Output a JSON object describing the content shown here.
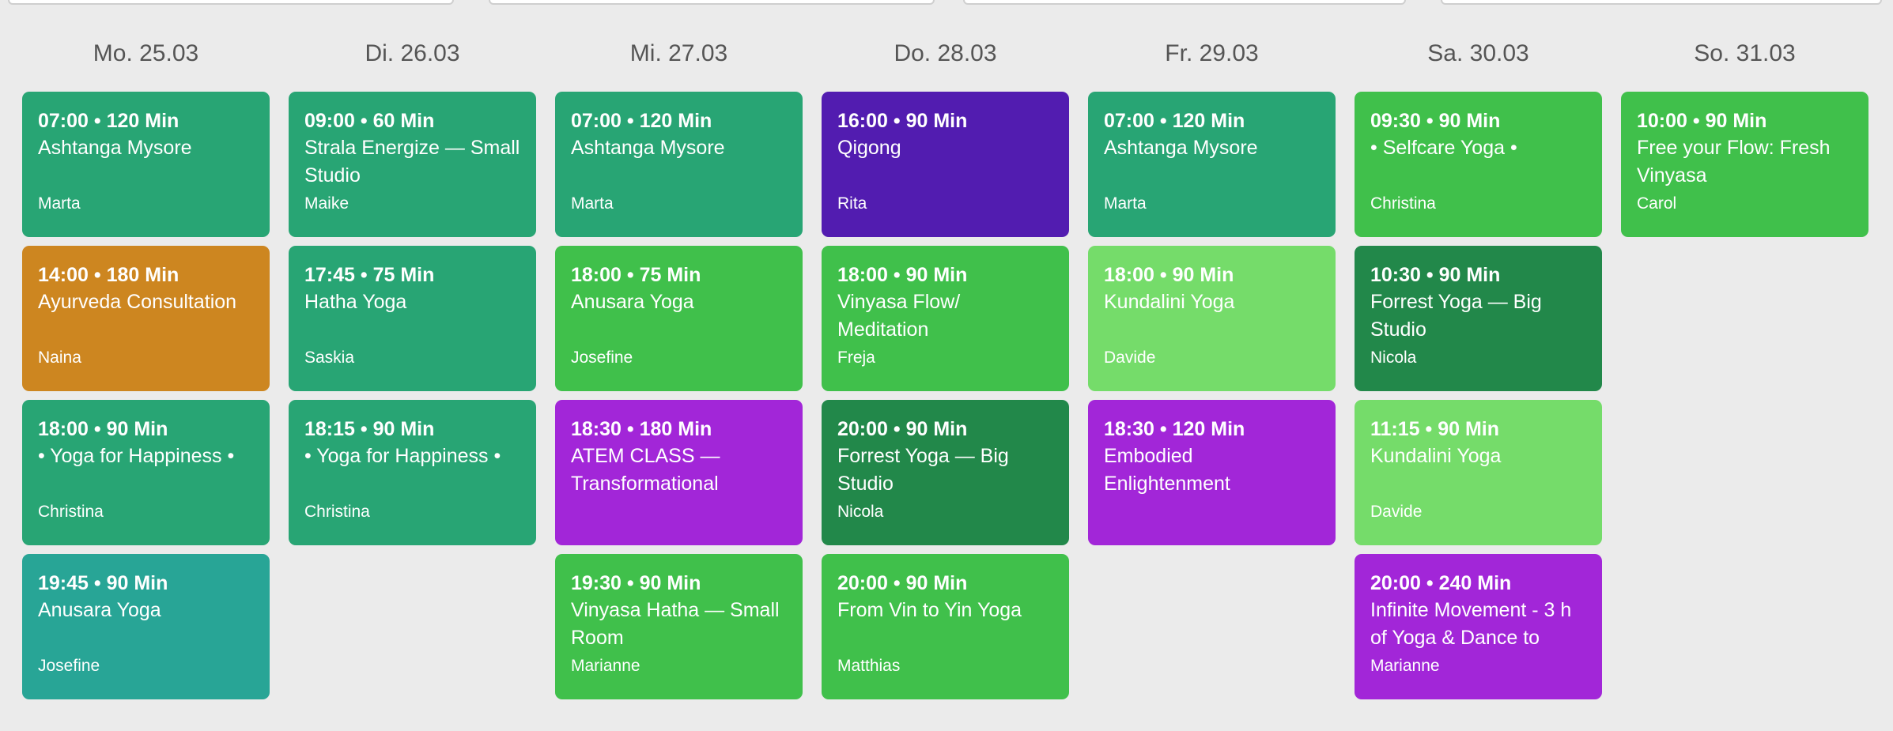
{
  "colors": {
    "teal": "#28a574",
    "dark_teal": "#28a596",
    "green": "#40c04b",
    "light_green": "#75dc6a",
    "dark_green": "#22884a",
    "purple": "#a226d8",
    "indigo": "#521cb0",
    "orange": "#cd8620",
    "background": "#ebebeb"
  },
  "days": [
    {
      "label": "Mo. 25.03",
      "classes": [
        {
          "time": "07:00 • 120 Min",
          "title": "Ashtanga Mysore",
          "teacher": "Marta",
          "color": "#28a574"
        },
        {
          "time": "14:00 • 180 Min",
          "title": "Ayurveda Consultation",
          "teacher": "Naina",
          "color": "#cd8620"
        },
        {
          "time": "18:00 • 90 Min",
          "title": "• Yoga for Happiness •",
          "teacher": "Christina",
          "color": "#28a574"
        },
        {
          "time": "19:45 • 90 Min",
          "title": "Anusara Yoga",
          "teacher": "Josefine",
          "color": "#28a596"
        }
      ]
    },
    {
      "label": "Di. 26.03",
      "classes": [
        {
          "time": "09:00 • 60 Min",
          "title": "Strala Energize — Small Studio",
          "teacher": "Maike",
          "color": "#28a574"
        },
        {
          "time": "17:45 • 75 Min",
          "title": "Hatha Yoga",
          "teacher": "Saskia",
          "color": "#28a574"
        },
        {
          "time": "18:15 • 90 Min",
          "title": "• Yoga for Happiness •",
          "teacher": "Christina",
          "color": "#28a574"
        }
      ]
    },
    {
      "label": "Mi. 27.03",
      "classes": [
        {
          "time": "07:00 • 120 Min",
          "title": "Ashtanga Mysore",
          "teacher": "Marta",
          "color": "#28a574"
        },
        {
          "time": "18:00 • 75 Min",
          "title": "Anusara Yoga",
          "teacher": "Josefine",
          "color": "#40c04b"
        },
        {
          "time": "18:30 • 180 Min",
          "title": "ATEM CLASS — Transformational",
          "teacher": "",
          "color": "#a226d8"
        },
        {
          "time": "19:30 • 90 Min",
          "title": "Vinyasa Hatha — Small Room",
          "teacher": "Marianne",
          "color": "#40c04b"
        }
      ]
    },
    {
      "label": "Do. 28.03",
      "classes": [
        {
          "time": "16:00 • 90 Min",
          "title": "Qigong",
          "teacher": "Rita",
          "color": "#521cb0"
        },
        {
          "time": "18:00 • 90 Min",
          "title": "Vinyasa Flow/ Meditation",
          "teacher": "Freja",
          "color": "#40c04b"
        },
        {
          "time": "20:00 • 90 Min",
          "title": "Forrest Yoga — Big Studio",
          "teacher": "Nicola",
          "color": "#22884a"
        },
        {
          "time": "20:00 • 90 Min",
          "title": "From Vin to Yin Yoga",
          "teacher": "Matthias",
          "color": "#40c04b"
        }
      ]
    },
    {
      "label": "Fr. 29.03",
      "classes": [
        {
          "time": "07:00 • 120 Min",
          "title": "Ashtanga Mysore",
          "teacher": "Marta",
          "color": "#28a574"
        },
        {
          "time": "18:00 • 90 Min",
          "title": "Kundalini Yoga",
          "teacher": "Davide",
          "color": "#75dc6a"
        },
        {
          "time": "18:30 • 120 Min",
          "title": "Embodied Enlightenment",
          "teacher": "",
          "color": "#a226d8"
        }
      ]
    },
    {
      "label": "Sa. 30.03",
      "classes": [
        {
          "time": "09:30 • 90 Min",
          "title": "• Selfcare Yoga •",
          "teacher": "Christina",
          "color": "#40c04b"
        },
        {
          "time": "10:30 • 90 Min",
          "title": "Forrest Yoga — Big Studio",
          "teacher": "Nicola",
          "color": "#22884a"
        },
        {
          "time": "11:15 • 90 Min",
          "title": "Kundalini Yoga",
          "teacher": "Davide",
          "color": "#75dc6a"
        },
        {
          "time": "20:00 • 240 Min",
          "title": "Infinite Movement - 3 h of Yoga & Dance to",
          "teacher": "Marianne",
          "color": "#a226d8"
        }
      ]
    },
    {
      "label": "So. 31.03",
      "classes": [
        {
          "time": "10:00 • 90 Min",
          "title": "Free your Flow: Fresh Vinyasa",
          "teacher": "Carol",
          "color": "#40c04b"
        }
      ]
    }
  ]
}
